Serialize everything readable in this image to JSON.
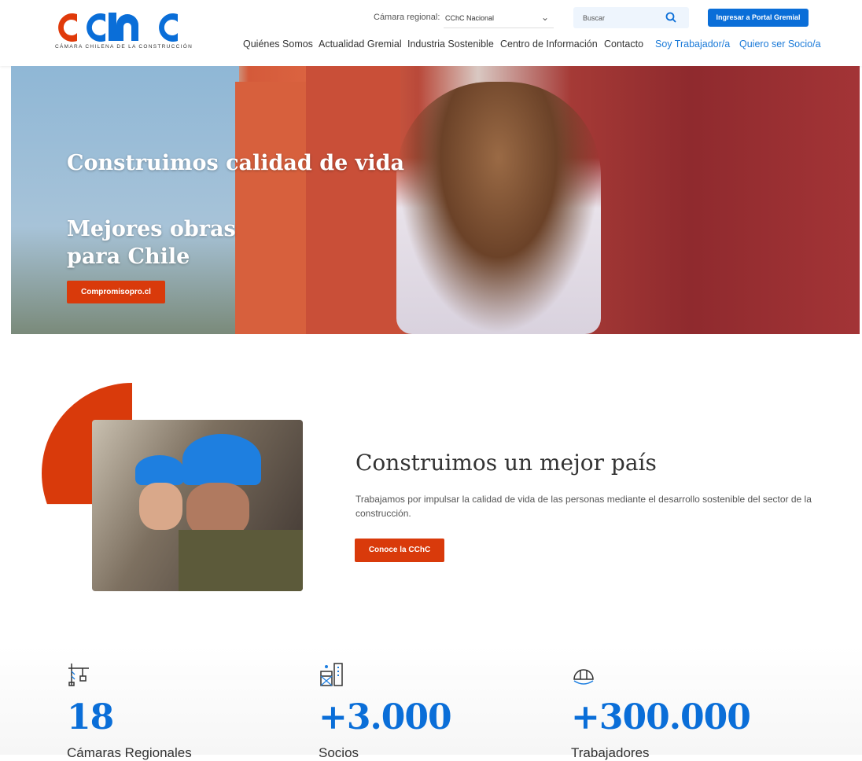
{
  "header": {
    "logo_text": "CÁMARA CHILENA DE LA CONSTRUCCIÓN",
    "region_label": "Cámara regional:",
    "region_value": "CChC Nacional",
    "search_placeholder": "Buscar",
    "portal_button": "Ingresar a Portal Gremial",
    "nav": [
      "Quiénes Somos",
      "Actualidad Gremial",
      "Industria Sostenible",
      "Centro de Información",
      "Contacto",
      "Soy Trabajador/a",
      "Quiero ser Socio/a"
    ]
  },
  "hero": {
    "title1": "Construimos calidad de vida",
    "title2": "Mejores obras para Chile",
    "button": "Compromisopro.cl"
  },
  "about": {
    "title": "Construimos un mejor país",
    "text": "Trabajamos por impulsar la calidad de vida de las personas mediante el desarrollo sostenible del sector de la construcción.",
    "button": "Conoce la CChC"
  },
  "stats": [
    {
      "icon": "crane-icon",
      "value": "18",
      "label": "Cámaras Regionales"
    },
    {
      "icon": "building-icon",
      "value": "+3.000",
      "label": "Socios"
    },
    {
      "icon": "hard-hat-icon",
      "value": "+300.000",
      "label": "Trabajadores"
    }
  ],
  "colors": {
    "brand_blue": "#0a6ed8",
    "brand_red": "#d93a0b"
  }
}
